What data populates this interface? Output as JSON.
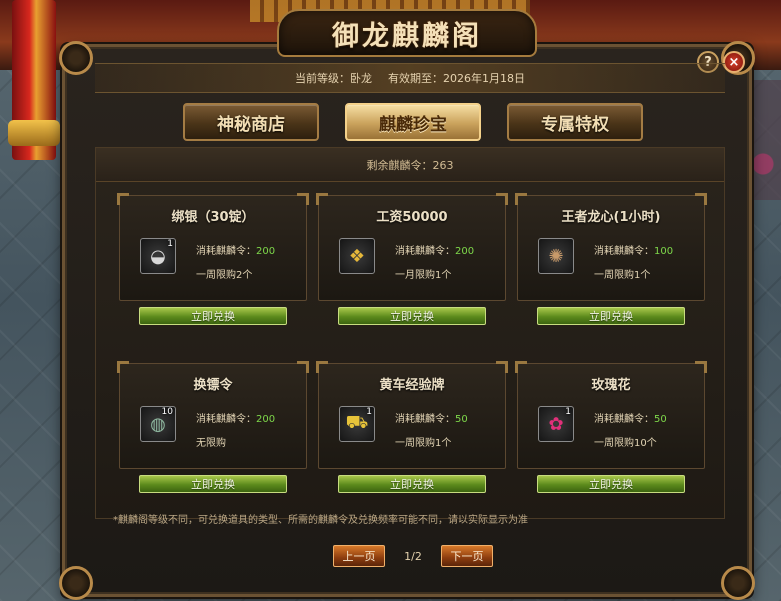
{
  "dialog": {
    "title": "御龙麒麟阁",
    "help_icon": "?",
    "close_icon": "×"
  },
  "info": {
    "level": "当前等级：卧龙",
    "expiry": "有效期至：2026年1月18日"
  },
  "tabs": [
    {
      "label": "神秘商店",
      "active": false
    },
    {
      "label": "麒麟珍宝",
      "active": true
    },
    {
      "label": "专属特权",
      "active": false
    }
  ],
  "remaining": "剩余麒麟令：263",
  "cost_label": "消耗麒麟令：",
  "items": [
    {
      "name": "绑银（30锭）",
      "icon": "silver-ingot-icon",
      "glyph": "◒",
      "qty": "1",
      "cost": "200",
      "limit": "一周限购2个",
      "button": "立即兑换"
    },
    {
      "name": "工资50000",
      "icon": "gold-pile-icon",
      "glyph": "❖",
      "qty": "",
      "cost": "200",
      "limit": "一月限购1个",
      "button": "立即兑换"
    },
    {
      "name": "王者龙心(1小时)",
      "icon": "dragon-heart-icon",
      "glyph": "✺",
      "qty": "",
      "cost": "100",
      "limit": "一周限购1个",
      "button": "立即兑换"
    },
    {
      "name": "换镖令",
      "icon": "jade-token-icon",
      "glyph": "◍",
      "qty": "10",
      "cost": "200",
      "limit": "无限购",
      "button": "立即兑换"
    },
    {
      "name": "黄车经验牌",
      "icon": "yellow-cart-icon",
      "glyph": "⛟",
      "qty": "1",
      "cost": "50",
      "limit": "一周限购1个",
      "button": "立即兑换"
    },
    {
      "name": "玫瑰花",
      "icon": "rose-icon",
      "glyph": "✿",
      "qty": "1",
      "cost": "50",
      "limit": "一周限购10个",
      "button": "立即兑换"
    }
  ],
  "note": "*麒麟阁等级不同，可兑换道具的类型、所需的麒麟令及兑换频率可能不同，请以实际显示为准",
  "pager": {
    "prev": "上一页",
    "page": "1/2",
    "next": "下一页"
  },
  "colors": {
    "accent_gold": "#caa25c",
    "cost_green": "#7ed84a",
    "button_green": "#5c8a1c",
    "pager_orange": "#d87a2a"
  }
}
